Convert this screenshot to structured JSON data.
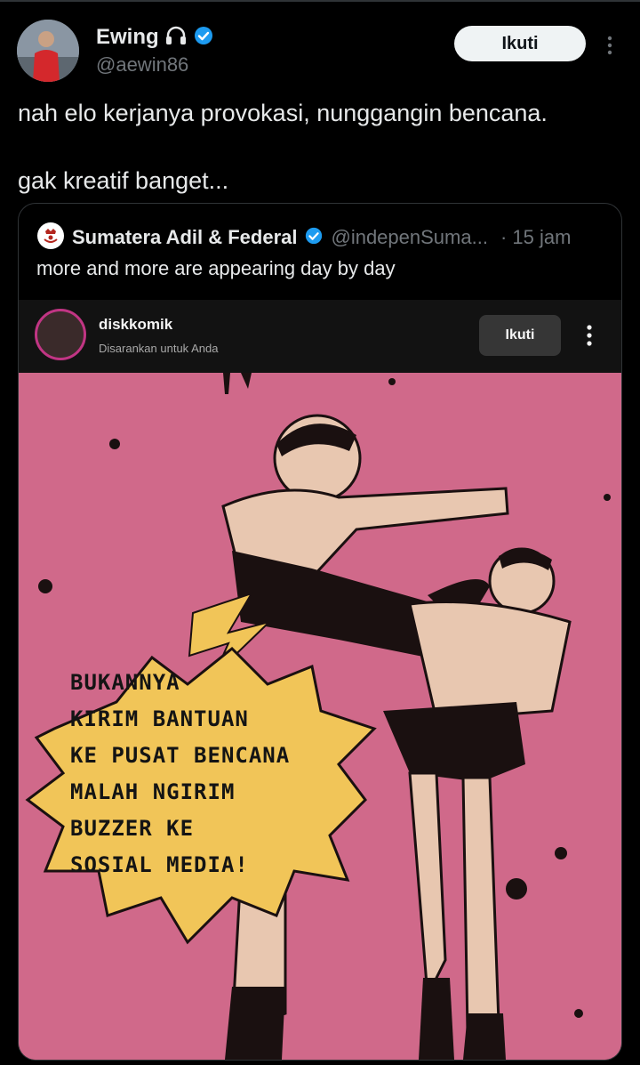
{
  "tweet": {
    "author_name": "Ewing",
    "author_handle": "@aewin86",
    "follow_label": "Ikuti",
    "text_line1": "nah elo kerjanya provokasi, nunggangin bencana.",
    "text_line2": "gak kreatif banget...",
    "colors": {
      "verified": "#1d9bf0",
      "background": "#000000"
    }
  },
  "quote": {
    "author_name": "Sumatera Adil & Federal",
    "author_handle": "@indepenSuma...",
    "time": "· 15 jam",
    "text": "more and more are appearing day by day"
  },
  "instagram_embed": {
    "username": "diskkomik",
    "suggested": "Disarankan untuk Anda",
    "follow_label": "Ikuti",
    "comic_lines": [
      "BUKANNYA",
      "KIRIM BANTUAN",
      "KE PUSAT BENCANA",
      "MALAH NGIRIM",
      "BUZZER KE",
      "SOSIAL MEDIA!"
    ]
  }
}
